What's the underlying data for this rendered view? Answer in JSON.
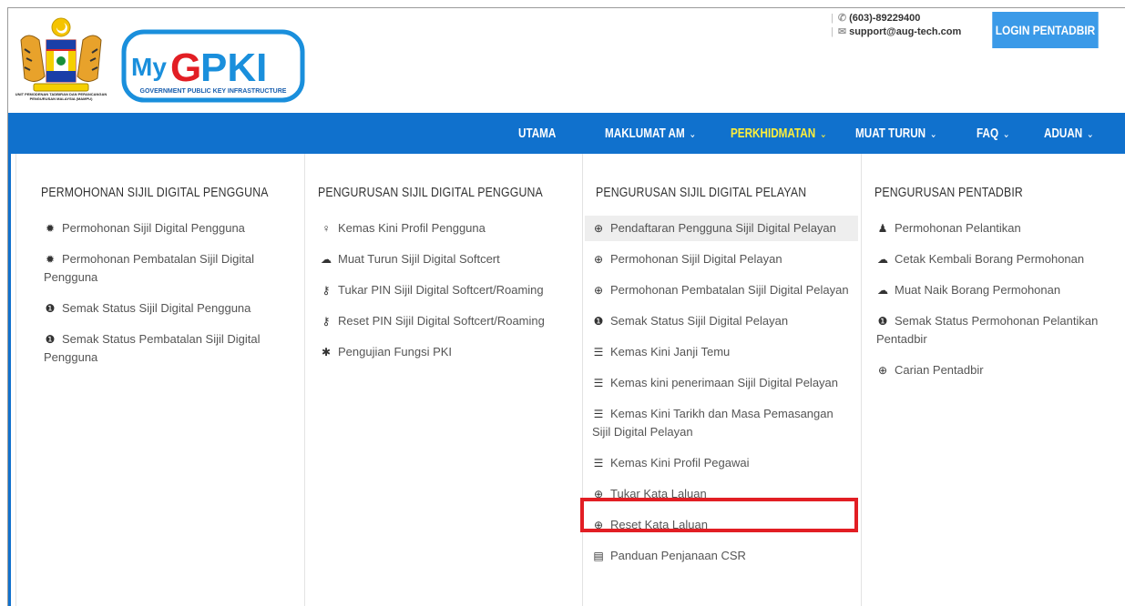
{
  "header": {
    "crest_caption": "UNIT PEMODENAN TADBIRAN DAN PERANCANGAN PENGURUSAN MALAYSIA (MAMPU)",
    "logo_text_my": "My",
    "logo_text_g": "G",
    "logo_text_pki": "PKI",
    "logo_subtitle": "GOVERNMENT PUBLIC KEY INFRASTRUCTURE",
    "phone": "(603)-89229400",
    "email": "support@aug-tech.com",
    "login_label": "LOGIN PENTADBIR"
  },
  "nav": {
    "items": [
      {
        "label": "UTAMA",
        "chevron": ""
      },
      {
        "label": "MAKLUMAT AM",
        "chevron": "⌄"
      },
      {
        "label": "PERKHIDMATAN",
        "chevron": "⌄"
      },
      {
        "label": "MUAT TURUN",
        "chevron": "⌄"
      },
      {
        "label": "FAQ",
        "chevron": "⌄"
      },
      {
        "label": "ADUAN",
        "chevron": "⌄"
      }
    ],
    "active_index": 2
  },
  "menu": {
    "columns": [
      {
        "title": "PERMOHONAN SIJIL DIGITAL PENGGUNA",
        "items": [
          {
            "icon": "gear-icon",
            "glyph": "✹",
            "label": "Permohonan Sijil Digital Pengguna"
          },
          {
            "icon": "gear-icon",
            "glyph": "✹",
            "label": "Permohonan Pembatalan Sijil Digital Pengguna"
          },
          {
            "icon": "info-icon",
            "glyph": "❶",
            "label": "Semak Status Sijil Digital Pengguna"
          },
          {
            "icon": "info-icon",
            "glyph": "❶",
            "label": "Semak Status Pembatalan Sijil Digital Pengguna"
          }
        ]
      },
      {
        "title": "PENGURUSAN SIJIL DIGITAL PENGGUNA",
        "items": [
          {
            "icon": "user-icon",
            "glyph": "♀",
            "label": "Kemas Kini Profil Pengguna"
          },
          {
            "icon": "cloud-download-icon",
            "glyph": "☁",
            "label": "Muat Turun Sijil Digital Softcert"
          },
          {
            "icon": "key-icon",
            "glyph": "⚷",
            "label": "Tukar PIN Sijil Digital Softcert/Roaming"
          },
          {
            "icon": "key-icon",
            "glyph": "⚷",
            "label": "Reset PIN Sijil Digital Softcert/Roaming"
          },
          {
            "icon": "asterisk-icon",
            "glyph": "✱",
            "label": "Pengujian Fungsi PKI"
          }
        ]
      },
      {
        "title": "PENGURUSAN SIJIL DIGITAL PELAYAN",
        "items": [
          {
            "icon": "lock-icon",
            "glyph": "⊕",
            "label": "Pendaftaran Pengguna Sijil Digital Pelayan"
          },
          {
            "icon": "lock-icon",
            "glyph": "⊕",
            "label": "Permohonan Sijil Digital Pelayan"
          },
          {
            "icon": "lock-icon",
            "glyph": "⊕",
            "label": "Permohonan Pembatalan Sijil Digital Pelayan"
          },
          {
            "icon": "info-icon",
            "glyph": "❶",
            "label": "Semak Status Sijil Digital Pelayan"
          },
          {
            "icon": "list-icon",
            "glyph": "☰",
            "label": "Kemas Kini Janji Temu"
          },
          {
            "icon": "list-icon",
            "glyph": "☰",
            "label": "Kemas kini penerimaan Sijil Digital Pelayan"
          },
          {
            "icon": "list-icon",
            "glyph": "☰",
            "label": "Kemas Kini Tarikh dan Masa Pemasangan Sijil Digital Pelayan"
          },
          {
            "icon": "list-icon",
            "glyph": "☰",
            "label": "Kemas Kini Profil Pegawai"
          },
          {
            "icon": "lock-icon",
            "glyph": "⊕",
            "label": "Tukar Kata Laluan"
          },
          {
            "icon": "lock-icon",
            "glyph": "⊕",
            "label": "Reset Kata Laluan"
          },
          {
            "icon": "document-icon",
            "glyph": "▤",
            "label": "Panduan Penjanaan CSR"
          }
        ]
      },
      {
        "title": "PENGURUSAN PENTADBIR",
        "items": [
          {
            "icon": "user-icon",
            "glyph": "♟",
            "label": "Permohonan Pelantikan"
          },
          {
            "icon": "cloud-icon",
            "glyph": "☁",
            "label": "Cetak Kembali Borang Permohonan"
          },
          {
            "icon": "cloud-upload-icon",
            "glyph": "☁",
            "label": "Muat Naik Borang Permohonan"
          },
          {
            "icon": "info-icon",
            "glyph": "❶",
            "label": "Semak Status Permohonan Pelantikan Pentadbir"
          },
          {
            "icon": "search-icon",
            "glyph": "⊕",
            "label": "Carian Pentadbir"
          }
        ]
      }
    ]
  },
  "colors": {
    "navbar": "#1071cd",
    "login_button": "#3b9ae8",
    "active_nav": "#ffef3a",
    "highlight_box": "#e21e24"
  }
}
